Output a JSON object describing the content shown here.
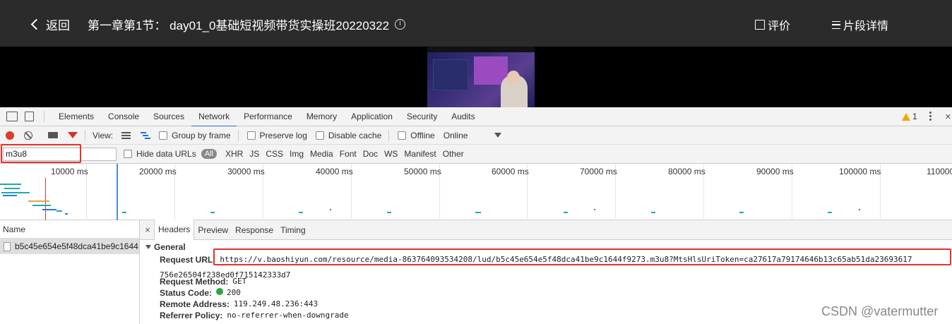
{
  "player": {
    "back_label": "返回",
    "title": "第一章第1节：  day01_0基础短视频带货实操班20220322",
    "info_glyph": "i",
    "rate_label": "评价",
    "detail_label": "片段详情"
  },
  "devtools": {
    "tabs": [
      "Elements",
      "Console",
      "Sources",
      "Network",
      "Performance",
      "Memory",
      "Application",
      "Security",
      "Audits"
    ],
    "active_tab": "Network",
    "warning_count": "1",
    "close_glyph": "×"
  },
  "network_toolbar": {
    "view_label": "View:",
    "group_by_frame": "Group by frame",
    "preserve_log": "Preserve log",
    "disable_cache": "Disable cache",
    "offline": "Offline",
    "throttle_value": "Online"
  },
  "filter": {
    "value": "m3u8",
    "hide_data_urls": "Hide data URLs",
    "types": [
      "All",
      "XHR",
      "JS",
      "CSS",
      "Img",
      "Media",
      "Font",
      "Doc",
      "WS",
      "Manifest",
      "Other"
    ],
    "active_type": "All"
  },
  "timeline": {
    "labels": [
      "10000 ms",
      "20000 ms",
      "30000 ms",
      "40000 ms",
      "50000 ms",
      "60000 ms",
      "70000 ms",
      "80000 ms",
      "90000 ms",
      "100000 ms",
      "110000"
    ]
  },
  "requests": {
    "column_header": "Name",
    "rows": [
      "b5c45e654e5f48dca41be9c1644..."
    ]
  },
  "details": {
    "close_glyph": "×",
    "tabs": [
      "Headers",
      "Preview",
      "Response",
      "Timing"
    ],
    "active_tab": "Headers",
    "section_title": "General",
    "request_url_key": "Request URL:",
    "request_url_line1": "https://v.baoshiyun.com/resource/media-863764093534208/lud/b5c45e654e5f48dca41be9c1644f9273.m3u8?MtsHlsUriToken=ca27617a79174646b13c65ab51da23693617",
    "request_url_line2": "756e26504f238ed0f715142333d7",
    "request_method_key": "Request Method:",
    "request_method": "GET",
    "status_code_key": "Status Code:",
    "status_code": "200",
    "remote_address_key": "Remote Address:",
    "remote_address": "119.249.48.236:443",
    "referrer_policy_key": "Referrer Policy:",
    "referrer_policy": "no-referrer-when-downgrade"
  },
  "watermark": "CSDN @vatermutter",
  "colors": {
    "highlight": "#e4322b",
    "record": "#e03b2d",
    "active_tab_underline": "#1a73e8",
    "status_ok": "#29a745"
  }
}
